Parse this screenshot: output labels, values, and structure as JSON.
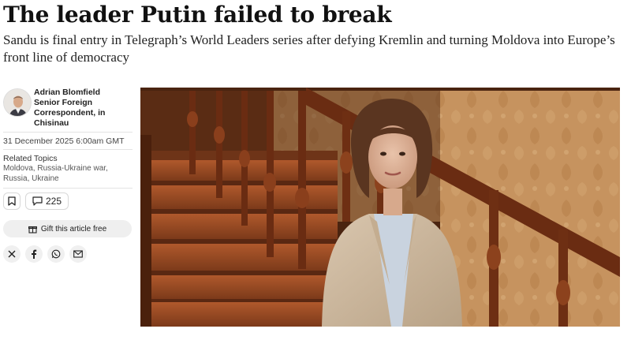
{
  "article": {
    "headline": "The leader Putin failed to break",
    "standfirst": "Sandu is final entry in Telegraph’s World Leaders series after defying Kremlin and turning Moldova into Europe’s front line of democracy"
  },
  "byline": {
    "author": "Adrian Blomfield",
    "role_line1": "Senior Foreign",
    "role_line2": "Correspondent, in",
    "location": "Chisinau",
    "date": "31 December 2025 6:00am GMT"
  },
  "topics": {
    "heading": "Related Topics",
    "list": "Moldova, Russia-Ukraine war, Russia, Ukraine"
  },
  "actions": {
    "comment_count": "225",
    "gift_label": "Gift this article free"
  },
  "icons": {
    "bookmark": "bookmark-icon",
    "comment": "comment-icon",
    "gift": "gift-icon",
    "share": [
      "x-icon",
      "facebook-icon",
      "whatsapp-icon",
      "email-icon"
    ]
  }
}
